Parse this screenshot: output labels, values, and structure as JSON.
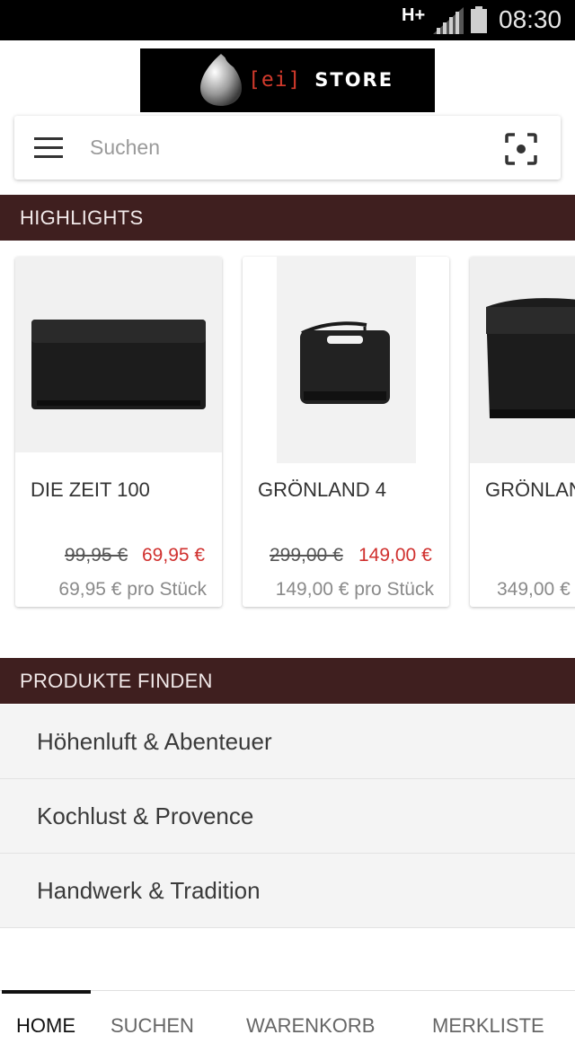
{
  "status_bar": {
    "network": "H+",
    "time": "08:30"
  },
  "logo": {
    "bracket_text": "[ei]",
    "store_text": "STORE"
  },
  "search": {
    "placeholder": "Suchen",
    "menu_icon": "hamburger-menu-icon",
    "scan_icon": "scan-icon"
  },
  "highlights": {
    "title": "HIGHLIGHTS",
    "products": [
      {
        "name": "DIE ZEIT 100",
        "old_price": "99,95 €",
        "new_price": "69,95 €",
        "unit_price": "69,95 € pro Stück"
      },
      {
        "name": "GRÖNLAND 4",
        "old_price": "299,00 €",
        "new_price": "149,00 €",
        "unit_price": "149,00 € pro Stück"
      },
      {
        "name": "GRÖNLAN",
        "unit_price": "349,00 €"
      }
    ]
  },
  "find_products": {
    "title": "PRODUKTE FINDEN",
    "items": [
      "Höhenluft & Abenteuer",
      "Kochlust & Provence",
      "Handwerk & Tradition"
    ]
  },
  "tabs": [
    "HOME",
    "SUCHEN",
    "WARENKORB",
    "MERKLISTE"
  ],
  "colors": {
    "header_bg": "#3f1f1f",
    "sale_price": "#d0302e",
    "status_bar": "#000000"
  }
}
